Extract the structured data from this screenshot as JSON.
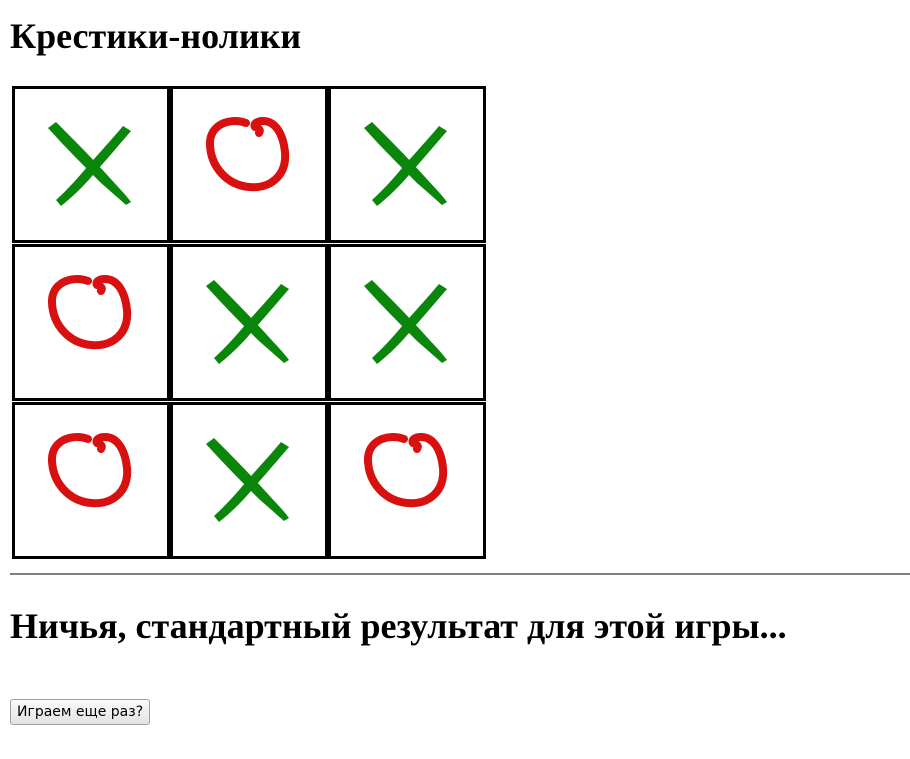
{
  "page": {
    "title": "Крестики-нолики"
  },
  "board": {
    "cells": [
      "X",
      "O",
      "X",
      "O",
      "X",
      "X",
      "O",
      "X",
      "O"
    ]
  },
  "colors": {
    "x_mark": "#0a860a",
    "o_mark": "#d81010",
    "cell_border": "#000000",
    "divider": "#808080"
  },
  "result": {
    "message": "Ничья, стандартный результат для этой игры..."
  },
  "controls": {
    "replay_label": "Играем еще раз?"
  }
}
